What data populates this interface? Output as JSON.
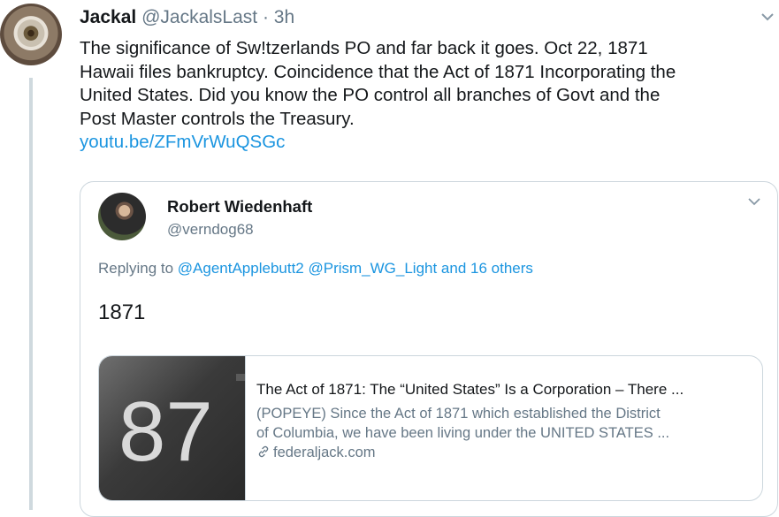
{
  "tweet": {
    "author_name": "Jackal",
    "author_handle": "@JackalsLast",
    "separator": " · ",
    "time": "3h",
    "text_lines": [
      "The significance of Sw!tzerlands PO and far back it goes.  Oct 22, 1871",
      "Hawaii files bankruptcy.  Coincidence that the Act of 1871 Incorporating the",
      "United States.  Did you know the PO control all branches of Govt and the",
      "Post Master controls the Treasury."
    ],
    "link": "youtu.be/ZFmVrWuQSGc",
    "avatar_icon": "eye-avatar",
    "menu_icon": "chevron-down-icon"
  },
  "quoted": {
    "author_name": "Robert Wiedenhaft",
    "author_handle": "@verndog68",
    "replying_prefix": "Replying to ",
    "replying_mentions": "@AgentApplebutt2 @Prism_WG_Light and 16 others",
    "text": "1871",
    "menu_icon": "chevron-down-icon",
    "card": {
      "image_text": "87",
      "title": "The Act of 1871: The “United States” Is a Corporation – There ...",
      "description_lines": [
        "(POPEYE)   Since the Act of 1871 which established the District",
        "of Columbia, we have been living under the UNITED STATES ..."
      ],
      "domain": "federaljack.com",
      "domain_icon": "link-icon"
    }
  },
  "colors": {
    "link": "#1b95e0",
    "secondary_text": "#657786",
    "border": "#ccd6dd"
  }
}
